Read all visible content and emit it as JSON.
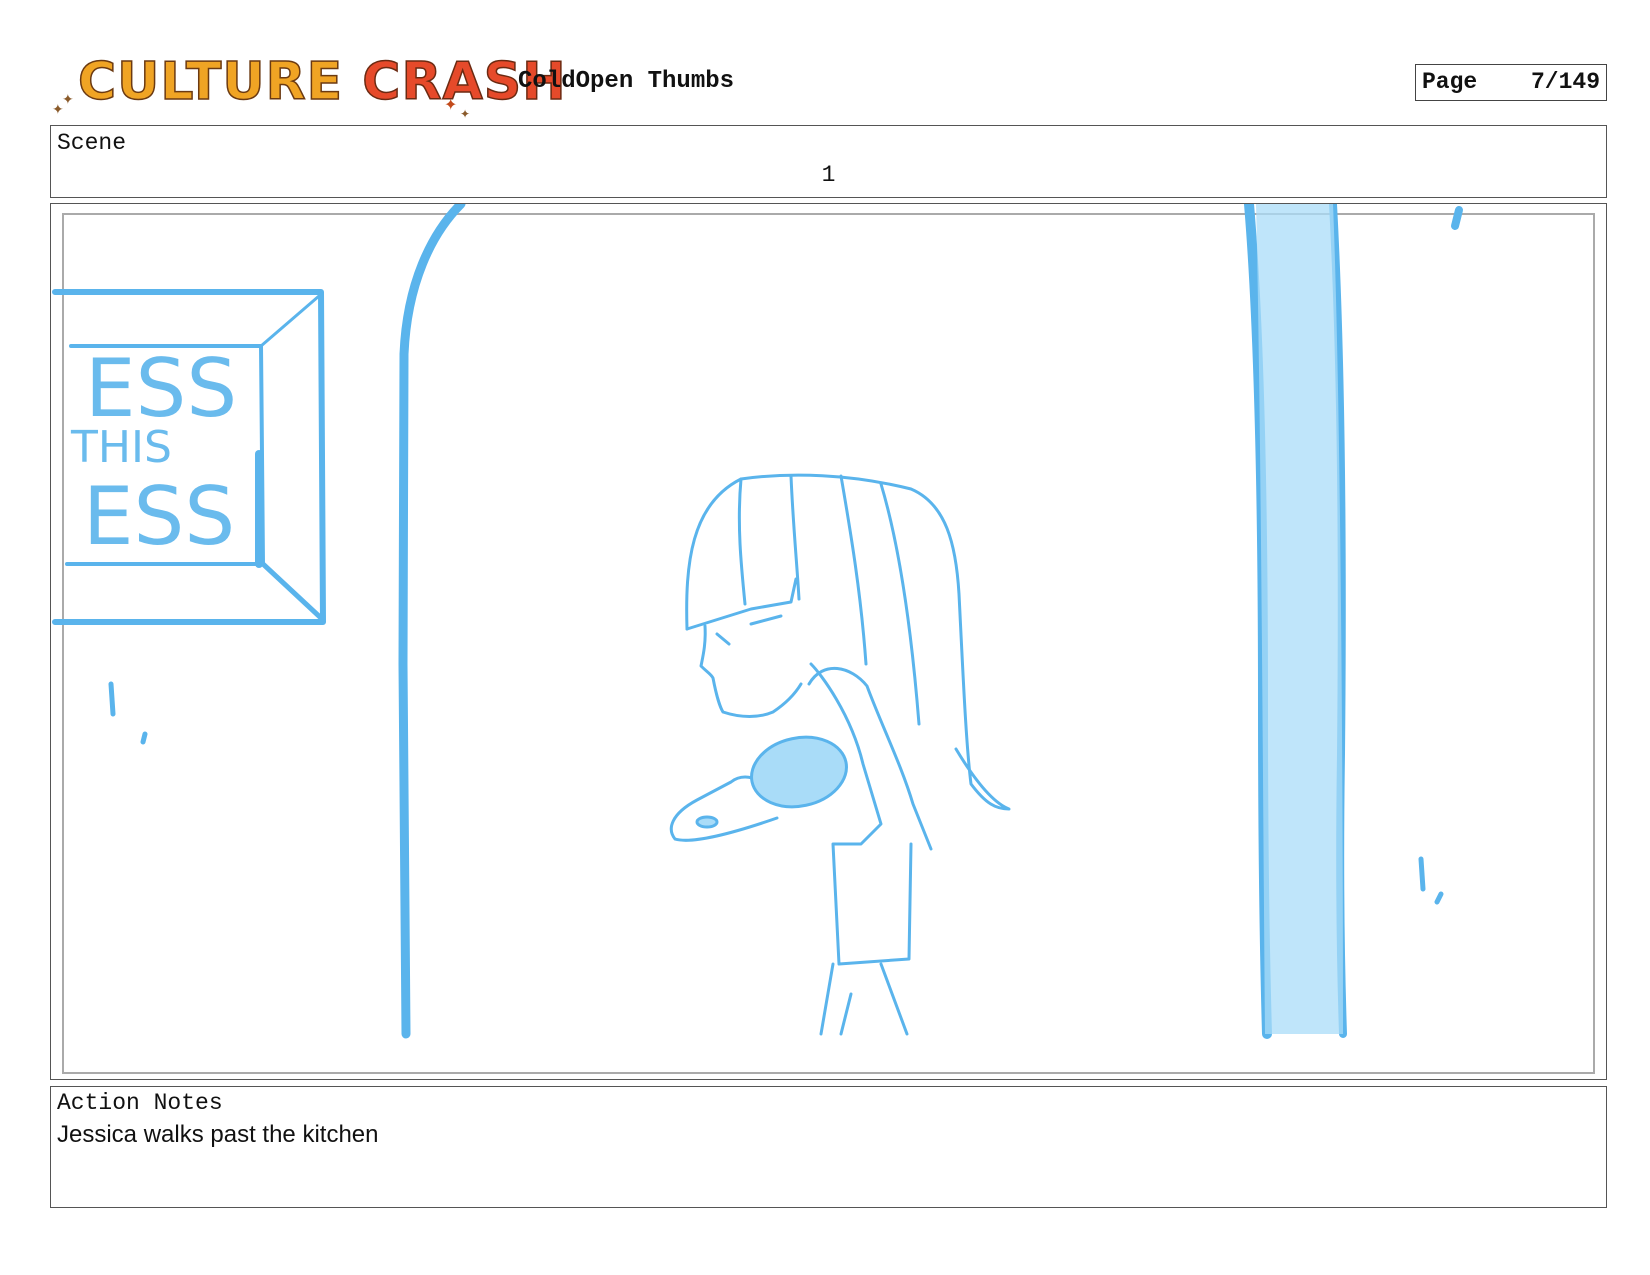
{
  "header": {
    "logo_word1": "CULTURE",
    "logo_word2": "CRASH",
    "doc_title": "ColdOpen Thumbs",
    "page_label": "Page",
    "page_value": "7/149"
  },
  "scene": {
    "label": "Scene",
    "number": "1"
  },
  "panel": {
    "sign_lines": [
      "ESS",
      "THIS",
      "ESS"
    ],
    "stroke_color": "#5ab4ec",
    "fill_color": "#a9dcf8"
  },
  "notes": {
    "label": "Action Notes",
    "text": "Jessica walks past the kitchen"
  }
}
